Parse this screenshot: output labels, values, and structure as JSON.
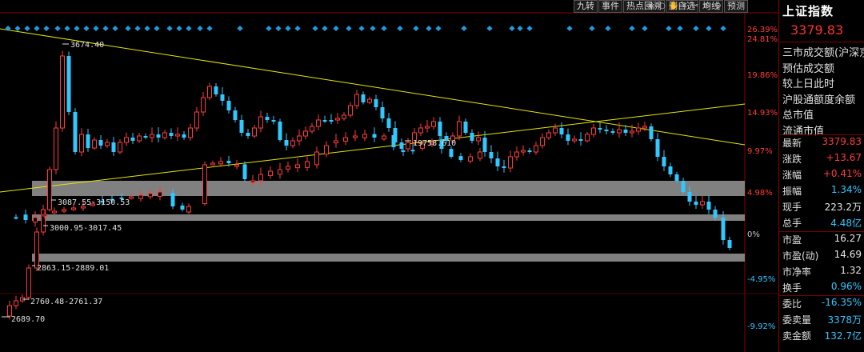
{
  "toolbar": {
    "tabs": [
      "九转",
      "事件",
      "热点回溯",
      "删自选",
      "均线",
      "预测"
    ],
    "icons": [
      "eye-icon",
      "circle-icon",
      "hand-icon",
      "cross-icon",
      "scissors-icon",
      "zoom-in-icon",
      "zoom-out-icon"
    ]
  },
  "right_panel": {
    "title": "上证指数",
    "price": "3379.83",
    "lines": [
      "三市成交额(沪深京",
      "预估成交额",
      "较上日此时",
      "沪股通额度余额",
      "总市值",
      "流通市值"
    ],
    "rows": [
      {
        "k": "最新",
        "v": "3379.83",
        "c": "red"
      },
      {
        "k": "涨跌",
        "v": "+13.67",
        "c": "red"
      },
      {
        "k": "涨幅",
        "v": "+0.41%",
        "c": "red"
      },
      {
        "k": "振幅",
        "v": "1.34%",
        "c": "cyan"
      },
      {
        "k": "现手",
        "v": "223.2万",
        "c": "wht"
      },
      {
        "k": "总手",
        "v": "4.48亿",
        "c": "cyan"
      }
    ],
    "rows2": [
      {
        "k": "市盈",
        "v": "16.27",
        "c": "wht"
      },
      {
        "k": "市盈(动)",
        "v": "14.69",
        "c": "wht"
      },
      {
        "k": "市净率",
        "v": "1.32",
        "c": "wht"
      },
      {
        "k": "换手",
        "v": "0.96%",
        "c": "cyan"
      }
    ],
    "rows3": [
      {
        "k": "委比",
        "v": "-16.35%",
        "c": "cyan"
      },
      {
        "k": "委卖量",
        "v": "3378万",
        "c": "cyan"
      },
      {
        "k": "卖金额",
        "v": "132.7亿",
        "c": "cyan"
      }
    ]
  },
  "chart_data": {
    "type": "candlestick",
    "y_axis_percent_labels": [
      "26.39%",
      "24.81%",
      "19.86%",
      "14.93%",
      "9.97%",
      "4.98%",
      "0%",
      "-4.95%",
      "-9.92%"
    ],
    "annotations": [
      {
        "text": "3674.40",
        "kind": "high"
      },
      {
        "text": "19758.610",
        "kind": "label"
      },
      {
        "text": "3087.55-3150.53",
        "kind": "zone"
      },
      {
        "text": "3000.95-3017.45",
        "kind": "zone"
      },
      {
        "text": "2863.15-2889.01",
        "kind": "zone"
      },
      {
        "text": "2760.48-2761.37",
        "kind": "level"
      },
      {
        "text": "2689.70",
        "kind": "low"
      }
    ],
    "zones": [
      {
        "low": 3087.55,
        "high": 3150.53
      },
      {
        "low": 3000.95,
        "high": 3017.45
      },
      {
        "low": 2863.15,
        "high": 2889.01
      }
    ],
    "last_price": 3379.83,
    "up_color": "#ff3c3c",
    "down_color": "#30c8ff",
    "trendline_color": "#e6e600",
    "zone_color": "#808080",
    "marker_color": "#1e9be0"
  }
}
